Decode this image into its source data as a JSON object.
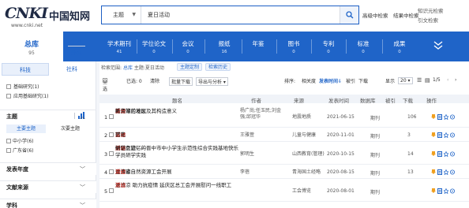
{
  "header": {
    "logo_mark": "CNKI",
    "logo_cn": "中国知网",
    "logo_url": "www.cnki.net",
    "search_field": "主题",
    "search_value": "夏日活动",
    "advanced_search": "高级中检索",
    "search_in_results": "结果中检索",
    "knowledge_link": "知识元检索",
    "citation_link": "引文检索"
  },
  "resource_tabs": {
    "total_label": "总库",
    "total_count": "95",
    "lang_cn": "中文",
    "lang_en": "外文",
    "tabs": [
      {
        "label": "学术期刊",
        "count": "41"
      },
      {
        "label": "学位论文",
        "count": "0"
      },
      {
        "label": "会议",
        "count": "0"
      },
      {
        "label": "报纸",
        "count": "16"
      },
      {
        "label": "年鉴",
        "count": ""
      },
      {
        "label": "图书",
        "count": "0"
      },
      {
        "label": "专利",
        "count": "0"
      },
      {
        "label": "标准",
        "count": "0"
      },
      {
        "label": "成果",
        "count": "0"
      }
    ]
  },
  "sidebar": {
    "tab_science": "科技",
    "tab_social": "社科",
    "checks": [
      "基础研究(1)",
      "应用基础研究(1)"
    ],
    "section_topic": "主题",
    "sub_tab_main": "主要主题",
    "sub_tab_secondary": "次要主题",
    "topic_items": [
      "中小学(6)",
      "广东省(6)"
    ],
    "section_year": "发表年度",
    "section_source": "文献来源",
    "section_discipline": "学科"
  },
  "content": {
    "crumb_label": "检索范围:",
    "crumb_value": "总库",
    "crumb_query": "主题:夏日活动",
    "pill_1": "主题定制",
    "pill_2": "检索历史",
    "toolbar": {
      "select_all": "全选",
      "selected": "已选: 0",
      "clear": "清除",
      "batch_download": "批量下载",
      "export": "导出与分析 ▾",
      "sort_label": "排序:",
      "sort_relevance": "相关度",
      "sort_date": "发表时间⇩",
      "sort_cited": "被引",
      "sort_download": "下载",
      "display_label": "显示",
      "display_count": "20 ▾",
      "page": "1/5"
    },
    "columns": [
      "题名",
      "作者",
      "来源",
      "发表时间",
      "数据库",
      "被引",
      "下载",
      "操作"
    ],
    "rows": [
      {
        "num": "1",
        "title_pre": "青海湖兰地区",
        "title_hl": "夏日",
        "title_mid": "哈",
        "title_hl2": "活动",
        "title_post": "新资带的发现及其构造意义",
        "author": "杨广尚;任玉民;刘金强;邱冠华",
        "source": "地震地质",
        "date": "2021-06-15",
        "db": "期刊",
        "cite": "",
        "dl": "106"
      },
      {
        "num": "2",
        "title_pre": "艺术",
        "title_hl": "活动",
        "title_mid": ":",
        "title_hl2": "夏日",
        "title_post": "荷花",
        "author": "王雅萱",
        "source": "儿童与健康",
        "date": "2020-11-01",
        "db": "期刊",
        "cite": "",
        "dl": "3"
      },
      {
        "num": "3",
        "title_pre": "一场有记忆的",
        "title_hl": "夏日",
        "title_mid": "研学之旅——晋中市中小学生示范性综合实践基地快乐学员研学实践",
        "title_hl2": "活动",
        "title_post": "侧记",
        "author": "郭明生",
        "source": "山西教育(管理)",
        "date": "2020-10-15",
        "db": "期刊",
        "cite": "",
        "dl": "14"
      },
      {
        "num": "4",
        "title_pre": "青海省自然资源工会开展",
        "title_hl": "夏日",
        "title_mid": "送清凉",
        "title_hl2": "活动",
        "title_post": "",
        "author": "李蓓",
        "source": "青海国土经略",
        "date": "2020-08-15",
        "db": "期刊",
        "cite": "",
        "dl": "13"
      },
      {
        "num": "5",
        "title_pre": "",
        "title_hl": "夏日",
        "title_mid": "送清凉 助力抗疫情 延庆区总工会开展慰问一线职工",
        "title_hl2": "活动",
        "title_post": "",
        "author": "",
        "source": "工会博览",
        "date": "2020-08-01",
        "db": "期刊",
        "cite": "",
        "dl": ""
      }
    ]
  },
  "colors": {
    "brand_blue": "#1f64c8",
    "highlight_red": "#e03a2f",
    "download_orange": "#f0a020"
  }
}
